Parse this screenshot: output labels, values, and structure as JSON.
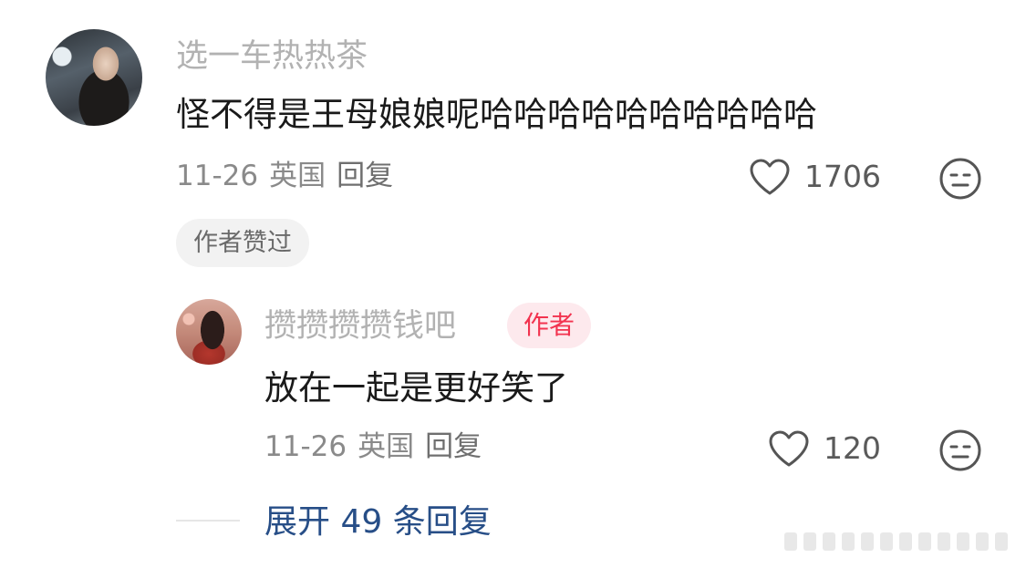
{
  "comments": [
    {
      "username": "选一车热热茶",
      "text": "怪不得是王母娘娘呢哈哈哈哈哈哈哈哈哈哈",
      "date": "11-26",
      "location": "英国",
      "reply_label": "回复",
      "like_count": "1706",
      "liked_badge": "作者赞过"
    }
  ],
  "replies": [
    {
      "username": "攒攒攒攒钱吧",
      "author_badge": "作者",
      "text": "放在一起是更好笑了",
      "date": "11-26",
      "location": "英国",
      "reply_label": "回复",
      "like_count": "120"
    }
  ],
  "expand_label": "展开 49 条回复",
  "icons": {
    "like": "heart-outline-icon",
    "dislike": "neutral-face-icon"
  },
  "colors": {
    "author_badge_text": "#f2334f",
    "author_badge_bg": "#fde9ed",
    "expand_link": "#274e87"
  }
}
